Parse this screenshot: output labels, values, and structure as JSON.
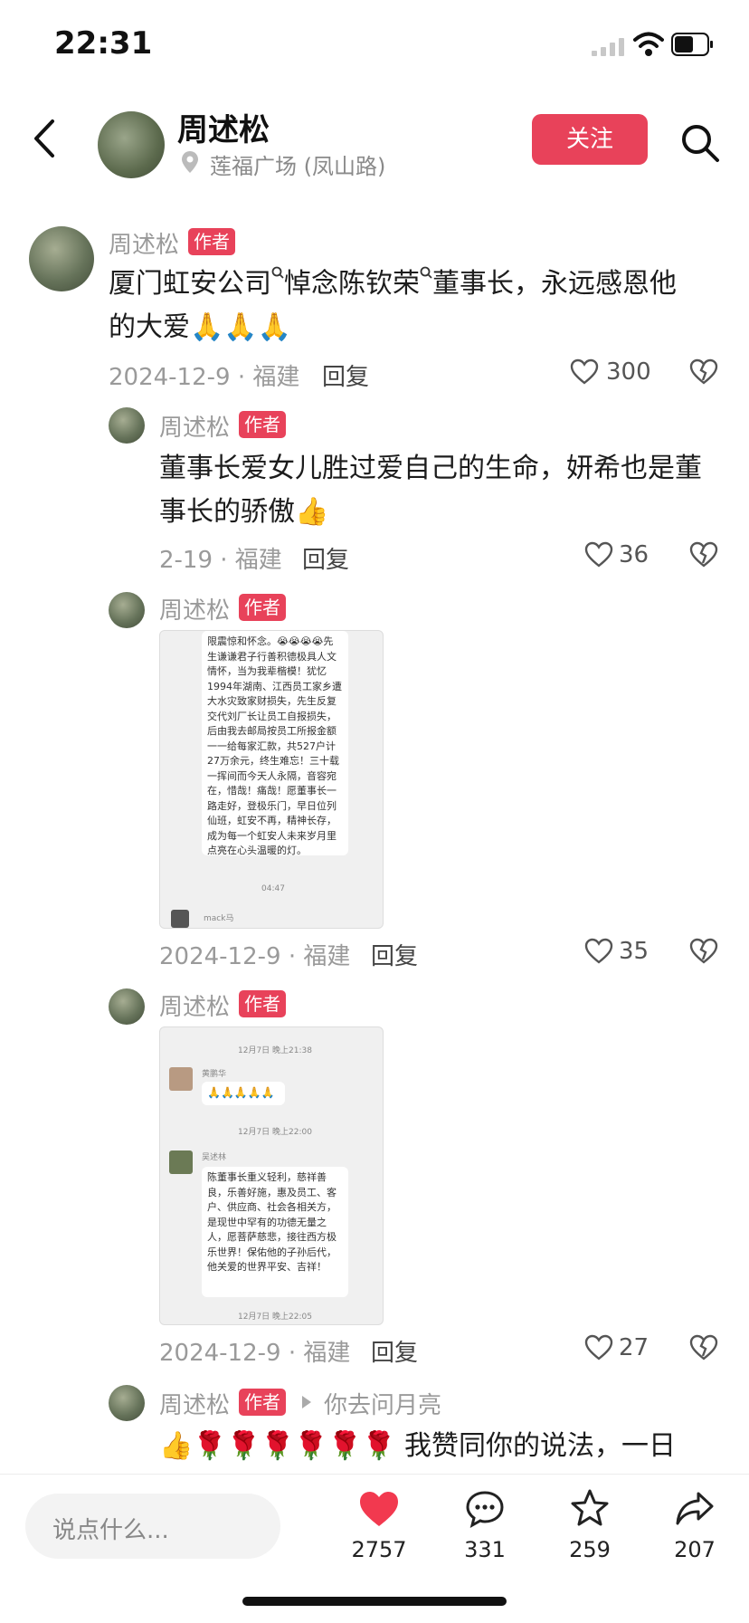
{
  "status": {
    "time": "22:31"
  },
  "header": {
    "name": "周述松",
    "location": "莲福广场 (凤山路)",
    "follow": "关注",
    "icons": {
      "back": "back-icon",
      "search": "search-icon"
    }
  },
  "main_comment": {
    "user": "周述松",
    "tag": "作者",
    "text_line1": "厦门虹安公司",
    "text_mid": "悼念陈钦荣",
    "text_end": "董事长，永远感恩他",
    "text_line2": "的大爱🙏🙏🙏",
    "meta": "2024-12-9 · 福建",
    "reply": "回复",
    "likes": "300"
  },
  "replies": [
    {
      "user": "周述松",
      "tag": "作者",
      "text_line1": "董事长爱女儿胜过爱自己的生命，妍希也是董",
      "text_line2": "事长的骄傲👍",
      "meta": "2-19 · 福建",
      "reply": "回复",
      "likes": "36"
    },
    {
      "user": "周述松",
      "tag": "作者",
      "meta": "2024-12-9 · 福建",
      "reply": "回复",
      "likes": "35",
      "image": {
        "text": "限震惊和怀念。😭😭😭😭先生谦谦君子行善积德极具人文情怀，当为我辈楷模！犹忆1994年湖南、江西员工家乡遭大水灾致家财损失，先生反复交代刘厂长让员工自报损失，后由我去邮局按员工所报金额一一给每家汇款，共527户计27万余元，终生难忘！三十载一挥间而今天人永隔，音容宛在，惜哉！痛哉！愿董事长一路走好，登极乐门，早日位列仙班，虹安不再，精神长存，成为每一个虹安人未来岁月里点亮在心头温暖的灯。",
        "time": "04:47",
        "sender": "mack马"
      }
    },
    {
      "user": "周述松",
      "tag": "作者",
      "meta": "2024-12-9 · 福建",
      "reply": "回复",
      "likes": "27",
      "image": {
        "time1": "12月7日 晚上21:38",
        "sender1": "黄鹏华",
        "msg1": "🙏🙏🙏🙏🙏",
        "time2": "12月7日 晚上22:00",
        "sender2": "吴述林",
        "msg2": "陈董事长重义轻利，慈祥善良，乐善好施，惠及员工、客户、供应商、社会各相关方，是现世中罕有的功德无量之人，愿菩萨慈悲，接往西方极乐世界！保佑他的子孙后代，他关爱的世界平安、吉祥！",
        "time3": "12月7日 晚上22:05"
      }
    },
    {
      "user": "周述松",
      "tag": "作者",
      "reply_to": "你去问月亮",
      "text_line1": "👍🌹🌹🌹🌹🌹🌹 我赞同你的说法，一日"
    }
  ],
  "bottom": {
    "placeholder": "说点什么...",
    "likes": "2757",
    "comments": "331",
    "stars": "259",
    "shares": "207"
  }
}
